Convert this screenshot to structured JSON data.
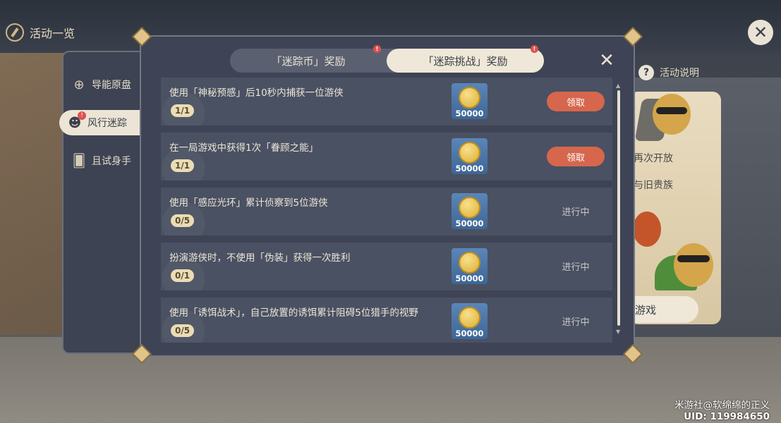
{
  "header": {
    "title": "活动一览"
  },
  "sidebar": {
    "items": [
      {
        "label": "导能原盘",
        "icon": "compass-target-icon",
        "active": false,
        "badge": ""
      },
      {
        "label": "风行迷踪",
        "icon": "masked-cat-icon",
        "active": true,
        "badge": "!"
      },
      {
        "label": "且试身手",
        "icon": "cards-icon",
        "active": false,
        "badge": ""
      }
    ]
  },
  "tabs": [
    {
      "label": "「迷踪币」奖励",
      "active": false,
      "badge": "!"
    },
    {
      "label": "「迷踪挑战」奖励",
      "active": true,
      "badge": "!"
    }
  ],
  "tasks": [
    {
      "description": "使用「神秘预感」后10秒内捕获一位游侠",
      "progress": "1/1",
      "reward_count": "50000",
      "action": "领取",
      "claimable": true
    },
    {
      "description": "在一局游戏中获得1次「眷顾之能」",
      "progress": "1/1",
      "reward_count": "50000",
      "action": "领取",
      "claimable": true
    },
    {
      "description": "使用「感应光环」累计侦察到5位游侠",
      "progress": "0/5",
      "reward_count": "50000",
      "action": "进行中",
      "claimable": false
    },
    {
      "description": "扮演游侠时，不使用「伪装」获得一次胜利",
      "progress": "0/1",
      "reward_count": "50000",
      "action": "进行中",
      "claimable": false
    },
    {
      "description": "使用「诱饵战术」，自己放置的诱饵累计阻碍5位猎手的视野",
      "progress": "0/5",
      "reward_count": "50000",
      "action": "进行中",
      "claimable": false
    }
  ],
  "right_panel": {
    "info_label": "活动说明",
    "text_1": "再次开放",
    "text_2": "与旧贵族",
    "game_button": "游戏"
  },
  "watermark": {
    "line1": "米游社@软绵绵的正义",
    "line2": "UID: 119984650"
  },
  "colors": {
    "claim_button": "#d6664c",
    "active_tab": "#efe8d8",
    "modal_bg": "#3e4455",
    "progress_pill": "#eadcb6"
  }
}
